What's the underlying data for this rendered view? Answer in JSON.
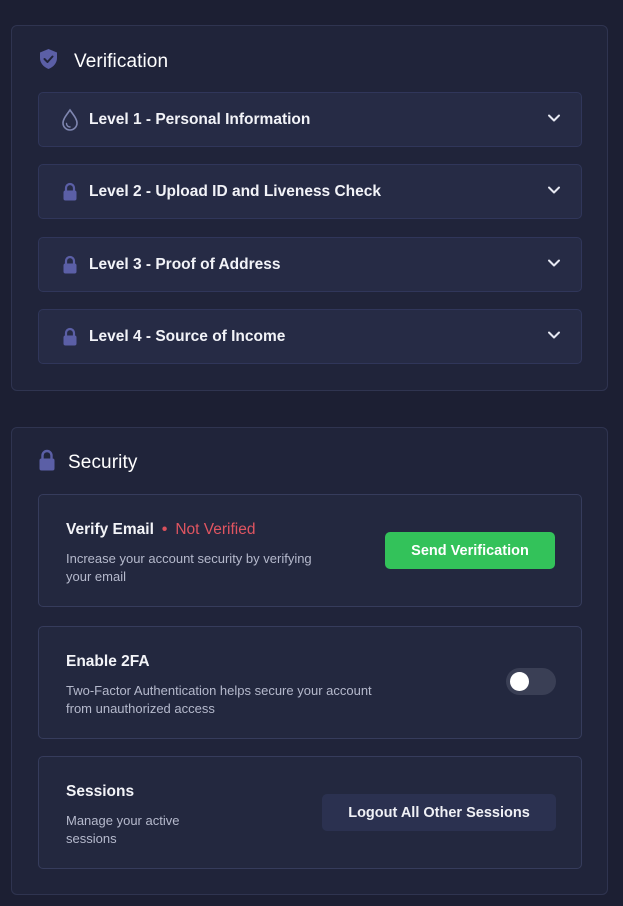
{
  "verification": {
    "title": "Verification",
    "icon": "shield-icon",
    "levels": [
      {
        "label": "Level 1 - Personal Information",
        "icon": "drop-icon"
      },
      {
        "label": "Level 2 - Upload ID and Liveness Check",
        "icon": "lock-icon"
      },
      {
        "label": "Level 3 - Proof of Address",
        "icon": "lock-icon"
      },
      {
        "label": "Level 4 - Source of Income",
        "icon": "lock-icon"
      }
    ]
  },
  "security": {
    "title": "Security",
    "icon": "lock-icon",
    "verify_email": {
      "title": "Verify Email",
      "separator": "•",
      "status": "Not Verified",
      "description_line1": "Increase your account security by verifying",
      "description_line2": "your email",
      "button_label": "Send Verification"
    },
    "two_fa": {
      "title": "Enable 2FA",
      "description_line1": "Two-Factor Authentication helps secure your account",
      "description_line2": "from unauthorized access",
      "enabled": false
    },
    "sessions": {
      "title": "Sessions",
      "description_line1": "Manage your active",
      "description_line2": "sessions",
      "button_label": "Logout All Other Sessions"
    }
  },
  "colors": {
    "background": "#1c1f33",
    "panel": "#20243a",
    "accent_icon": "#5b5fa6",
    "success": "#33c25a",
    "danger": "#e05561"
  }
}
